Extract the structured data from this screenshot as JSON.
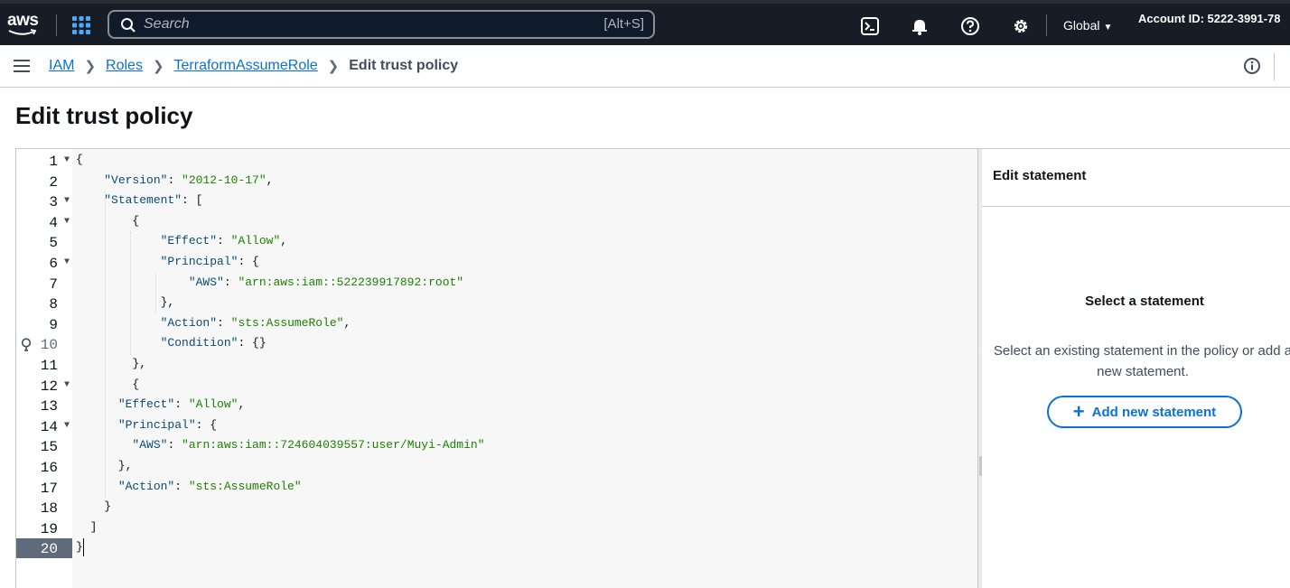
{
  "topbar": {
    "logo_text": "aws",
    "search_placeholder": "Search",
    "search_shortcut": "[Alt+S]",
    "icons": [
      "services-grid-icon",
      "cloudshell-icon",
      "notifications-bell-icon",
      "help-icon",
      "settings-gear-icon"
    ],
    "region": "Global",
    "account": "Account ID: 5222-3991-78"
  },
  "breadcrumbs": {
    "items": [
      "IAM",
      "Roles",
      "TerraformAssumeRole"
    ],
    "current": "Edit trust policy"
  },
  "page": {
    "title": "Edit trust policy"
  },
  "editor": {
    "line_numbers": [
      "1",
      "2",
      "3",
      "4",
      "5",
      "6",
      "7",
      "8",
      "9",
      "10",
      "11",
      "12",
      "13",
      "14",
      "15",
      "16",
      "17",
      "18",
      "19",
      "20"
    ],
    "foldable_lines": [
      1,
      3,
      4,
      6,
      12,
      14
    ],
    "active_line": 20,
    "warning_line": 10,
    "lines": [
      "{",
      "    \"Version\": \"2012-10-17\",",
      "    \"Statement\": [",
      "        {",
      "            \"Effect\": \"Allow\",",
      "            \"Principal\": {",
      "                \"AWS\": \"arn:aws:iam::522239917892:root\"",
      "            },",
      "            \"Action\": \"sts:AssumeRole\",",
      "            \"Condition\": {}",
      "        },",
      "        {",
      "      \"Effect\": \"Allow\",",
      "      \"Principal\": {",
      "        \"AWS\": \"arn:aws:iam::724604039557:user/Muyi-Admin\"",
      "      },",
      "      \"Action\": \"sts:AssumeRole\"",
      "    }",
      "  ]",
      "}"
    ]
  },
  "side_panel": {
    "header": "Edit statement",
    "empty_title": "Select a statement",
    "empty_description": "Select an existing statement in the policy or add a new statement.",
    "add_button": "Add new statement"
  }
}
